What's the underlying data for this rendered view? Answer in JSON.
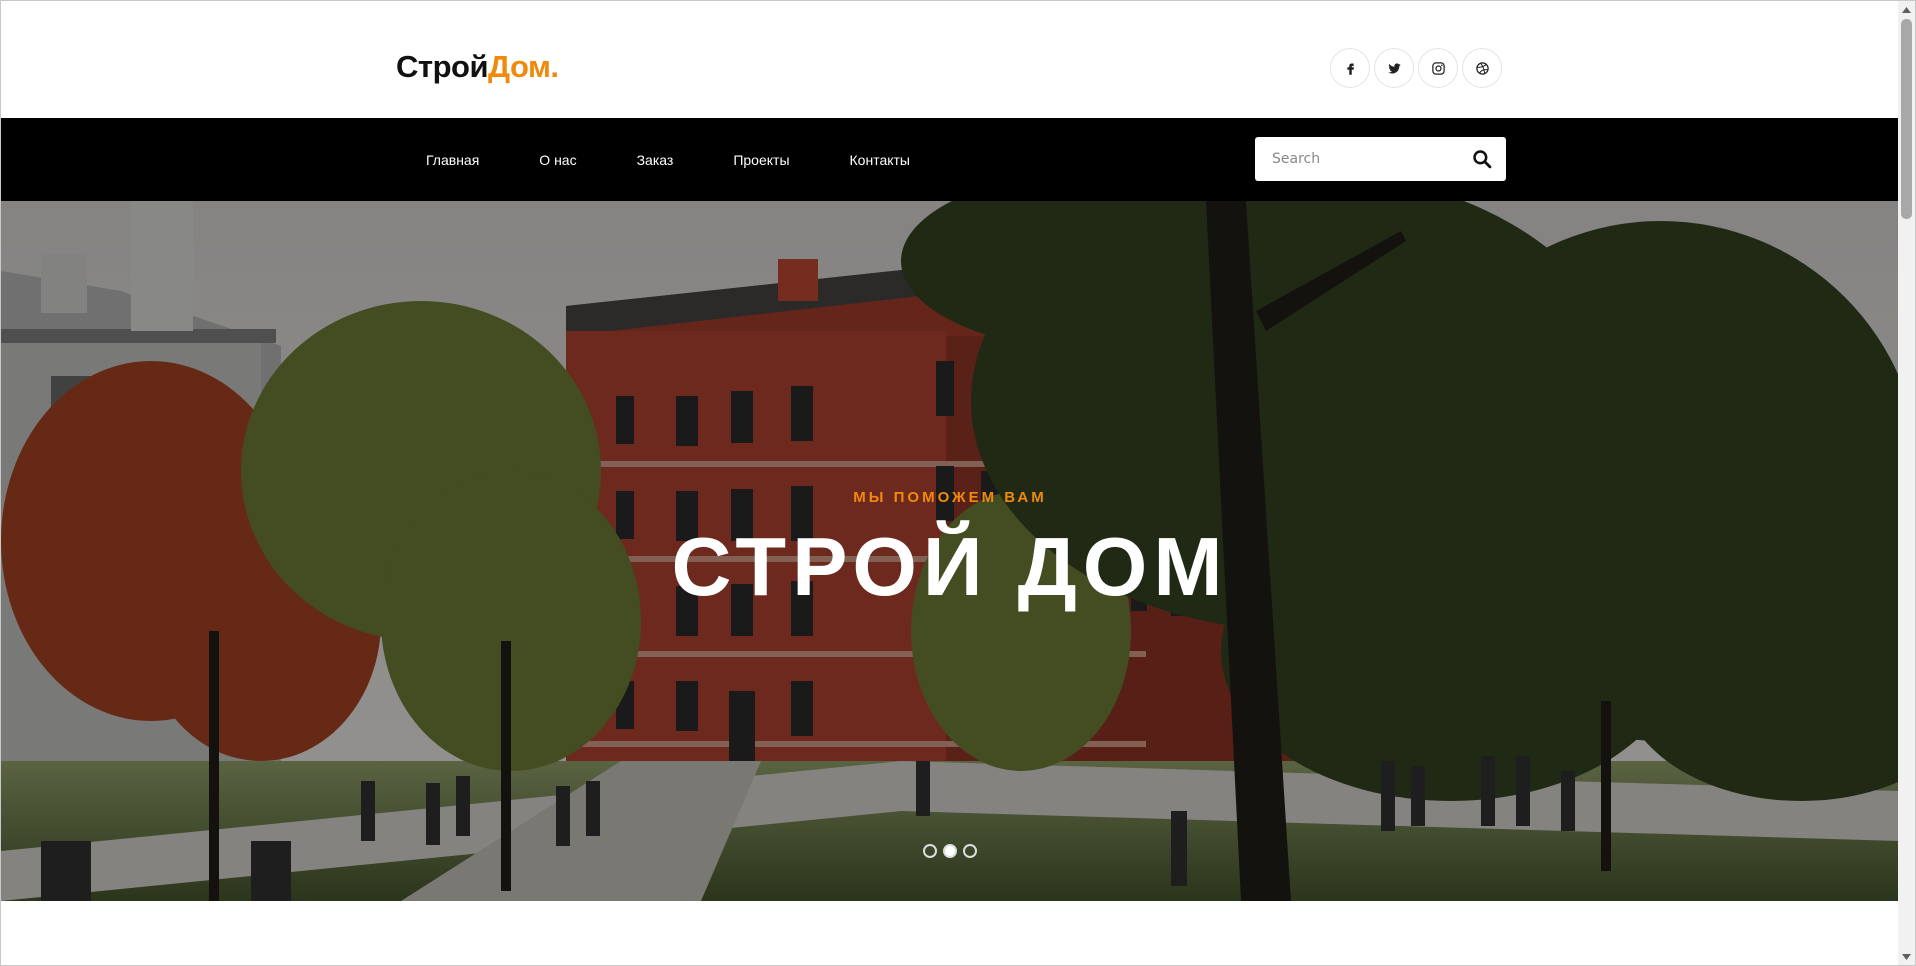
{
  "brand": {
    "part1": "Строй",
    "part2": "Дом."
  },
  "social": [
    "facebook-icon",
    "twitter-icon",
    "instagram-icon",
    "dribbble-icon"
  ],
  "nav": {
    "items": [
      "Главная",
      "О нас",
      "Заказ",
      "Проекты",
      "Контакты"
    ]
  },
  "search": {
    "placeholder": "Search",
    "value": ""
  },
  "hero": {
    "subtitle": "МЫ ПОМОЖЕМ ВАМ",
    "title": "СТРОЙ ДОМ",
    "slides": 3,
    "active_slide": 2
  },
  "colors": {
    "accent": "#f08a0c",
    "nav_bg": "#000000",
    "brick": "#8e3426"
  }
}
